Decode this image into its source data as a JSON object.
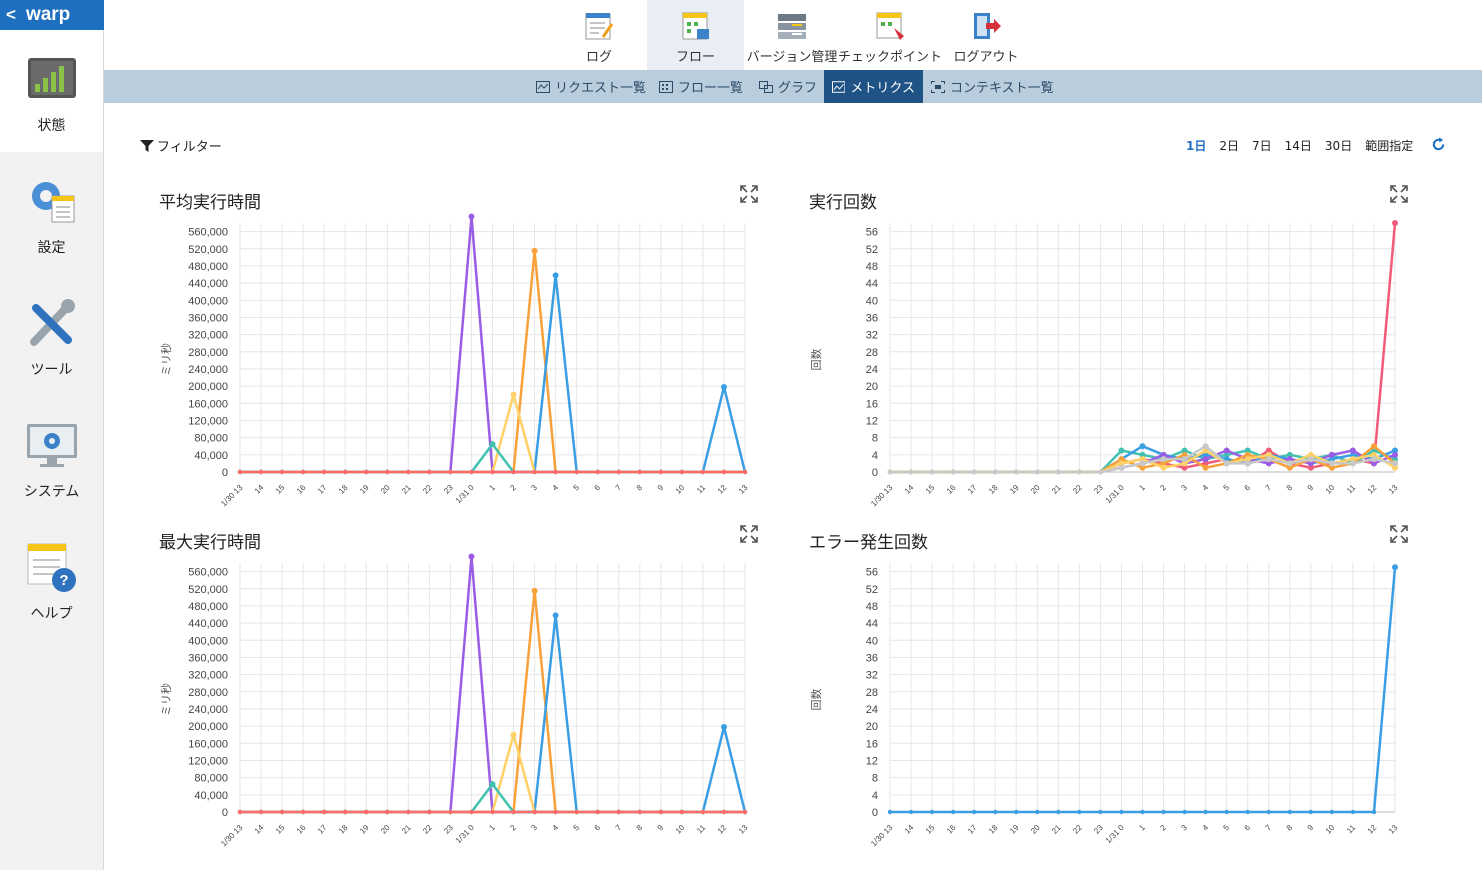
{
  "brand": "warp",
  "sidebar": {
    "items": [
      {
        "key": "status",
        "label": "状態"
      },
      {
        "key": "settings",
        "label": "設定"
      },
      {
        "key": "tools",
        "label": "ツール"
      },
      {
        "key": "system",
        "label": "システム"
      },
      {
        "key": "help",
        "label": "ヘルプ"
      }
    ]
  },
  "topnav": {
    "items": [
      {
        "label": "ログ"
      },
      {
        "label": "フロー"
      },
      {
        "label": "バージョン管理"
      },
      {
        "label": "チェックポイント"
      },
      {
        "label": "ログアウト"
      }
    ]
  },
  "subnav": {
    "items": [
      {
        "label": "リクエスト一覧"
      },
      {
        "label": "フロー一覧"
      },
      {
        "label": "グラフ"
      },
      {
        "label": "メトリクス"
      },
      {
        "label": "コンテキスト一覧"
      }
    ]
  },
  "filter": {
    "label": "フィルター"
  },
  "ranges": {
    "items": [
      "1日",
      "2日",
      "7日",
      "14日",
      "30日",
      "範囲指定"
    ],
    "selected": "1日"
  },
  "colors": {
    "accent": "#1e6fc0",
    "subnav_bg": "#b9cddd",
    "subnav_active": "#1f5285"
  },
  "chart_data": [
    {
      "id": "avg",
      "type": "line",
      "title": "平均実行時間",
      "ylabel": "ミリ秒",
      "ylim": [
        0,
        580000
      ],
      "yticks": [
        0,
        40000,
        80000,
        120000,
        160000,
        200000,
        240000,
        280000,
        320000,
        360000,
        400000,
        440000,
        480000,
        520000,
        560000
      ],
      "categories": [
        "1/30 13",
        "14",
        "15",
        "16",
        "17",
        "18",
        "19",
        "20",
        "21",
        "22",
        "23",
        "1/31 0",
        "1",
        "2",
        "3",
        "4",
        "5",
        "6",
        "7",
        "8",
        "9",
        "10",
        "11",
        "12",
        "13"
      ],
      "series": [
        {
          "color": "#9b5de5",
          "values": [
            0,
            0,
            0,
            0,
            0,
            0,
            0,
            0,
            0,
            0,
            0,
            595000,
            0,
            0,
            0,
            0,
            0,
            0,
            0,
            0,
            0,
            0,
            0,
            0,
            0
          ]
        },
        {
          "color": "#f7a13a",
          "values": [
            0,
            0,
            0,
            0,
            0,
            0,
            0,
            0,
            0,
            0,
            0,
            0,
            0,
            0,
            515000,
            0,
            0,
            0,
            0,
            0,
            0,
            0,
            0,
            0,
            0
          ]
        },
        {
          "color": "#3a9ee4",
          "values": [
            0,
            0,
            0,
            0,
            0,
            0,
            0,
            0,
            0,
            0,
            0,
            0,
            0,
            0,
            0,
            458000,
            0,
            0,
            0,
            0,
            0,
            0,
            0,
            198000,
            0
          ]
        },
        {
          "color": "#ffd166",
          "values": [
            0,
            0,
            0,
            0,
            0,
            0,
            0,
            0,
            0,
            0,
            0,
            0,
            0,
            180000,
            0,
            0,
            0,
            0,
            0,
            0,
            0,
            0,
            0,
            0,
            0
          ]
        },
        {
          "color": "#40c2b0",
          "values": [
            0,
            0,
            0,
            0,
            0,
            0,
            0,
            0,
            0,
            0,
            0,
            0,
            65000,
            0,
            0,
            0,
            0,
            0,
            0,
            0,
            0,
            0,
            0,
            0,
            0
          ]
        },
        {
          "color": "#ff6b6b",
          "values": [
            0,
            0,
            0,
            0,
            0,
            0,
            0,
            0,
            0,
            0,
            0,
            0,
            0,
            0,
            0,
            0,
            0,
            0,
            0,
            0,
            0,
            0,
            0,
            0,
            0
          ]
        }
      ]
    },
    {
      "id": "count",
      "type": "line",
      "title": "実行回数",
      "ylabel": "回数",
      "ylim": [
        0,
        58
      ],
      "yticks": [
        0,
        4,
        8,
        12,
        16,
        20,
        24,
        28,
        32,
        36,
        40,
        44,
        48,
        52,
        56
      ],
      "categories": [
        "1/30 13",
        "14",
        "15",
        "16",
        "17",
        "18",
        "19",
        "20",
        "21",
        "22",
        "23",
        "1/31 0",
        "1",
        "2",
        "3",
        "4",
        "5",
        "6",
        "7",
        "8",
        "9",
        "10",
        "11",
        "12",
        "13"
      ],
      "series": [
        {
          "color": "#f25c7a",
          "values": [
            0,
            0,
            0,
            0,
            0,
            0,
            0,
            0,
            0,
            0,
            0,
            2,
            3,
            2,
            1,
            2,
            3,
            2,
            5,
            2,
            1,
            2,
            3,
            2,
            58
          ]
        },
        {
          "color": "#40c2b0",
          "values": [
            0,
            0,
            0,
            0,
            0,
            0,
            0,
            0,
            0,
            0,
            0,
            5,
            4,
            3,
            5,
            3,
            4,
            5,
            3,
            4,
            3,
            4,
            2,
            5,
            3
          ]
        },
        {
          "color": "#3a9ee4",
          "values": [
            0,
            0,
            0,
            0,
            0,
            0,
            0,
            0,
            0,
            0,
            0,
            3,
            6,
            4,
            3,
            4,
            3,
            2,
            4,
            3,
            2,
            3,
            4,
            3,
            5
          ]
        },
        {
          "color": "#9b5de5",
          "values": [
            0,
            0,
            0,
            0,
            0,
            0,
            0,
            0,
            0,
            0,
            0,
            1,
            2,
            4,
            2,
            3,
            5,
            3,
            2,
            3,
            2,
            4,
            5,
            2,
            4
          ]
        },
        {
          "color": "#f7a13a",
          "values": [
            0,
            0,
            0,
            0,
            0,
            0,
            0,
            0,
            0,
            0,
            0,
            3,
            1,
            2,
            4,
            1,
            2,
            4,
            3,
            1,
            3,
            1,
            2,
            6,
            2
          ]
        },
        {
          "color": "#ffd166",
          "values": [
            0,
            0,
            0,
            0,
            0,
            0,
            0,
            0,
            0,
            0,
            0,
            2,
            3,
            1,
            2,
            5,
            2,
            3,
            4,
            2,
            4,
            2,
            3,
            4,
            1
          ]
        },
        {
          "color": "#c8c8c8",
          "values": [
            0,
            0,
            0,
            0,
            0,
            0,
            0,
            0,
            0,
            0,
            0,
            1,
            2,
            3,
            3,
            6,
            2,
            2,
            3,
            2,
            3,
            2,
            2,
            3,
            2
          ]
        }
      ]
    },
    {
      "id": "max",
      "type": "line",
      "title": "最大実行時間",
      "ylabel": "ミリ秒",
      "ylim": [
        0,
        580000
      ],
      "yticks": [
        0,
        40000,
        80000,
        120000,
        160000,
        200000,
        240000,
        280000,
        320000,
        360000,
        400000,
        440000,
        480000,
        520000,
        560000
      ],
      "categories": [
        "1/30 13",
        "14",
        "15",
        "16",
        "17",
        "18",
        "19",
        "20",
        "21",
        "22",
        "23",
        "1/31 0",
        "1",
        "2",
        "3",
        "4",
        "5",
        "6",
        "7",
        "8",
        "9",
        "10",
        "11",
        "12",
        "13"
      ],
      "series": [
        {
          "color": "#9b5de5",
          "values": [
            0,
            0,
            0,
            0,
            0,
            0,
            0,
            0,
            0,
            0,
            0,
            595000,
            0,
            0,
            0,
            0,
            0,
            0,
            0,
            0,
            0,
            0,
            0,
            0,
            0
          ]
        },
        {
          "color": "#f7a13a",
          "values": [
            0,
            0,
            0,
            0,
            0,
            0,
            0,
            0,
            0,
            0,
            0,
            0,
            0,
            0,
            515000,
            0,
            0,
            0,
            0,
            0,
            0,
            0,
            0,
            0,
            0
          ]
        },
        {
          "color": "#3a9ee4",
          "values": [
            0,
            0,
            0,
            0,
            0,
            0,
            0,
            0,
            0,
            0,
            0,
            0,
            0,
            0,
            0,
            458000,
            0,
            0,
            0,
            0,
            0,
            0,
            0,
            198000,
            0
          ]
        },
        {
          "color": "#ffd166",
          "values": [
            0,
            0,
            0,
            0,
            0,
            0,
            0,
            0,
            0,
            0,
            0,
            0,
            0,
            180000,
            0,
            0,
            0,
            0,
            0,
            0,
            0,
            0,
            0,
            0,
            0
          ]
        },
        {
          "color": "#40c2b0",
          "values": [
            0,
            0,
            0,
            0,
            0,
            0,
            0,
            0,
            0,
            0,
            0,
            0,
            65000,
            0,
            0,
            0,
            0,
            0,
            0,
            0,
            0,
            0,
            0,
            0,
            0
          ]
        },
        {
          "color": "#ff6b6b",
          "values": [
            0,
            0,
            0,
            0,
            0,
            0,
            0,
            0,
            0,
            0,
            0,
            0,
            0,
            0,
            0,
            0,
            0,
            0,
            0,
            0,
            0,
            0,
            0,
            0,
            0
          ]
        }
      ]
    },
    {
      "id": "err",
      "type": "line",
      "title": "エラー発生回数",
      "ylabel": "回数",
      "ylim": [
        0,
        58
      ],
      "yticks": [
        0,
        4,
        8,
        12,
        16,
        20,
        24,
        28,
        32,
        36,
        40,
        44,
        48,
        52,
        56
      ],
      "categories": [
        "1/30 13",
        "14",
        "15",
        "16",
        "17",
        "18",
        "19",
        "20",
        "21",
        "22",
        "23",
        "1/31 0",
        "1",
        "2",
        "3",
        "4",
        "5",
        "6",
        "7",
        "8",
        "9",
        "10",
        "11",
        "12",
        "13"
      ],
      "series": [
        {
          "color": "#3a9ee4",
          "values": [
            0,
            0,
            0,
            0,
            0,
            0,
            0,
            0,
            0,
            0,
            0,
            0,
            0,
            0,
            0,
            0,
            0,
            0,
            0,
            0,
            0,
            0,
            0,
            0,
            57
          ]
        }
      ]
    }
  ]
}
